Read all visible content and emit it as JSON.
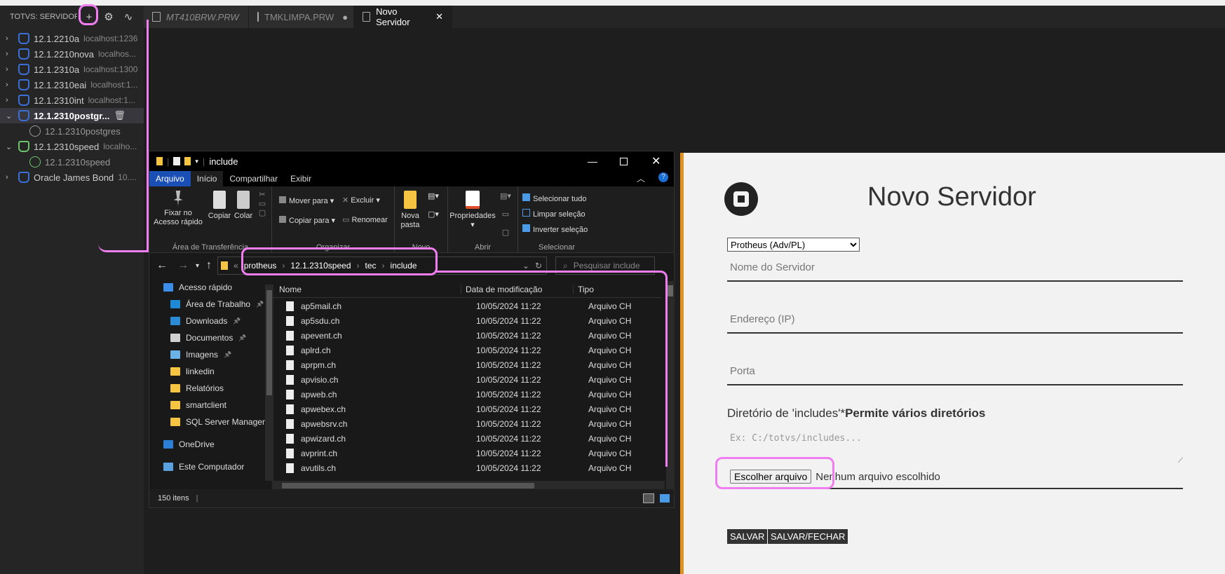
{
  "sidebar": {
    "title": "TOTVS: SERVIDOR...",
    "items": [
      {
        "label": "12.1.2210a",
        "host": "localhost:1236",
        "expanded": false
      },
      {
        "label": "12.1.2210nova",
        "host": "localhos...",
        "expanded": false
      },
      {
        "label": "12.1.2310a",
        "host": "localhost:1300",
        "expanded": false
      },
      {
        "label": "12.1.2310eai",
        "host": "localhost:1...",
        "expanded": false
      },
      {
        "label": "12.1.2310int",
        "host": "localhost:1...",
        "expanded": false
      },
      {
        "label": "12.1.2310postgr...",
        "host": "",
        "expanded": true
      },
      {
        "label": "12.1.2310postgres",
        "host": "",
        "child": true
      },
      {
        "label": "12.1.2310speed",
        "host": "localho...",
        "expanded": true
      },
      {
        "label": "12.1.2310speed",
        "host": "",
        "child": true
      },
      {
        "label": "Oracle James Bond",
        "host": "10....",
        "expanded": false
      }
    ]
  },
  "tabs": [
    {
      "label": "MT410BRW.PRW",
      "italic": true
    },
    {
      "label": "TMKLIMPA.PRW",
      "dot": "●"
    },
    {
      "label": "Novo Servidor",
      "close": "✕",
      "active": true
    }
  ],
  "explorer": {
    "title": "include",
    "menu": [
      "Arquivo",
      "Início",
      "Compartilhar",
      "Exibir"
    ],
    "ribbon": {
      "pin": "Fixar no\nAcesso rápido",
      "copy": "Copiar",
      "paste": "Colar",
      "group_clipboard": "Área de Transferência",
      "move_to": "Mover para",
      "copy_to": "Copiar para",
      "delete": "Excluir",
      "rename": "Renomear",
      "group_organize": "Organizar",
      "new_folder": "Nova\npasta",
      "group_new": "Novo",
      "properties": "Propriedades",
      "group_open": "Abrir",
      "select_all": "Selecionar tudo",
      "clear_selection": "Limpar seleção",
      "invert_selection": "Inverter seleção",
      "group_select": "Selecionar"
    },
    "breadcrumb": [
      "protheus",
      "12.1.2310speed",
      "tec",
      "include"
    ],
    "search_placeholder": "Pesquisar include",
    "nav": [
      {
        "label": "Acesso rápido",
        "color": "#3b8eea"
      },
      {
        "label": "Área de Trabalho",
        "color": "#1e8ad6",
        "pin": true
      },
      {
        "label": "Downloads",
        "color": "#2a8ad4",
        "pin": true
      },
      {
        "label": "Documentos",
        "color": "#d0d0d0",
        "pin": true
      },
      {
        "label": "Imagens",
        "color": "#6bb3e6",
        "pin": true
      },
      {
        "label": "linkedin",
        "color": "#f5c542"
      },
      {
        "label": "Relatórios",
        "color": "#f5c542"
      },
      {
        "label": "smartclient",
        "color": "#f5c542"
      },
      {
        "label": "SQL Server Managem",
        "color": "#f5c542"
      },
      {
        "label": "OneDrive",
        "color": "#2b7fd6"
      },
      {
        "label": "Este Computador",
        "color": "#5aa0e0"
      }
    ],
    "columns": {
      "name": "Nome",
      "date": "Data de modificação",
      "type": "Tipo"
    },
    "files": [
      {
        "name": "ap5mail.ch",
        "date": "10/05/2024 11:22",
        "type": "Arquivo CH"
      },
      {
        "name": "ap5sdu.ch",
        "date": "10/05/2024 11:22",
        "type": "Arquivo CH"
      },
      {
        "name": "apevent.ch",
        "date": "10/05/2024 11:22",
        "type": "Arquivo CH"
      },
      {
        "name": "aplrd.ch",
        "date": "10/05/2024 11:22",
        "type": "Arquivo CH"
      },
      {
        "name": "aprpm.ch",
        "date": "10/05/2024 11:22",
        "type": "Arquivo CH"
      },
      {
        "name": "apvisio.ch",
        "date": "10/05/2024 11:22",
        "type": "Arquivo CH"
      },
      {
        "name": "apweb.ch",
        "date": "10/05/2024 11:22",
        "type": "Arquivo CH"
      },
      {
        "name": "apwebex.ch",
        "date": "10/05/2024 11:22",
        "type": "Arquivo CH"
      },
      {
        "name": "apwebsrv.ch",
        "date": "10/05/2024 11:22",
        "type": "Arquivo CH"
      },
      {
        "name": "apwizard.ch",
        "date": "10/05/2024 11:22",
        "type": "Arquivo CH"
      },
      {
        "name": "avprint.ch",
        "date": "10/05/2024 11:22",
        "type": "Arquivo CH"
      },
      {
        "name": "avutils.ch",
        "date": "10/05/2024 11:22",
        "type": "Arquivo CH"
      }
    ],
    "status": "150 itens"
  },
  "form": {
    "title": "Novo Servidor",
    "server_type": "Protheus (Adv/PL)",
    "name_placeholder": "Nome do Servidor",
    "address_placeholder": "Endereço (IP)",
    "port_placeholder": "Porta",
    "includes_label": "Diretório de 'includes'*",
    "includes_note": "Permite vários diretórios",
    "includes_placeholder": "Ex: C:/totvs/includes...",
    "choose_file": "Escolher arquivo",
    "no_file": "Nenhum arquivo escolhido",
    "save": "SALVAR",
    "save_close": "SALVAR/FECHAR"
  }
}
